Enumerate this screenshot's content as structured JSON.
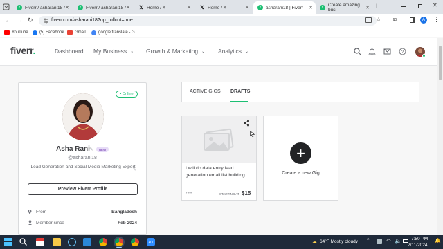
{
  "browser": {
    "tabs": [
      {
        "title": "Fiverr / asharani18 /",
        "icon": "fiverr-favicon",
        "active": false
      },
      {
        "title": "Fiverr / asharani18 /",
        "icon": "fiverr-favicon",
        "active": false
      },
      {
        "title": "Home / X",
        "icon": "x-favicon",
        "active": false
      },
      {
        "title": "Home / X",
        "icon": "x-favicon",
        "active": false
      },
      {
        "title": "asharani18 | Fiverr",
        "icon": "fiverr-favicon",
        "active": true
      },
      {
        "title": "Create amazing busi",
        "icon": "fiverr-favicon",
        "active": false
      }
    ],
    "new_tab": "+",
    "url": "fiverr.com/asharani18?up_rollout=true",
    "bookmarks": [
      "YouTube",
      "(5) Facebook",
      "Gmail",
      "google translate - G..."
    ]
  },
  "header": {
    "logo": "fiverr",
    "logo_dot": ".",
    "nav": [
      {
        "label": "Dashboard",
        "dropdown": false
      },
      {
        "label": "My Business",
        "dropdown": true
      },
      {
        "label": "Growth & Marketing",
        "dropdown": true
      },
      {
        "label": "Analytics",
        "dropdown": true
      }
    ],
    "chevron": "⌄"
  },
  "profile": {
    "status": "• Online",
    "name": "Asha Rani",
    "badge": "NEW",
    "handle": "@asharani18",
    "tagline": "Lead Generation and Social Media Marketing Expert",
    "preview_button": "Preview Fiverr Profile",
    "info": [
      {
        "label": "From",
        "value": "Bangladesh",
        "icon": "location-pin-icon"
      },
      {
        "label": "Member since",
        "value": "Feb 2024",
        "icon": "person-icon"
      }
    ]
  },
  "gigs": {
    "tabs": [
      {
        "label": "ACTIVE GIGS",
        "active": false
      },
      {
        "label": "DRAFTS",
        "active": true
      }
    ],
    "draft": {
      "title": "I will do data entry lead generation email list building",
      "dots": "•••",
      "starting_at": "STARTING AT",
      "price": "$15"
    },
    "create_label": "Create a new Gig",
    "create_plus": "+"
  },
  "taskbar": {
    "weather": "64°F  Mostly cloudy",
    "time": "7:50 PM",
    "date": "2/11/2024",
    "meet_badge": "zm"
  },
  "colors": {
    "brand": "#1dbf73",
    "text": "#404145",
    "taskbar": "#1f2a3a"
  }
}
